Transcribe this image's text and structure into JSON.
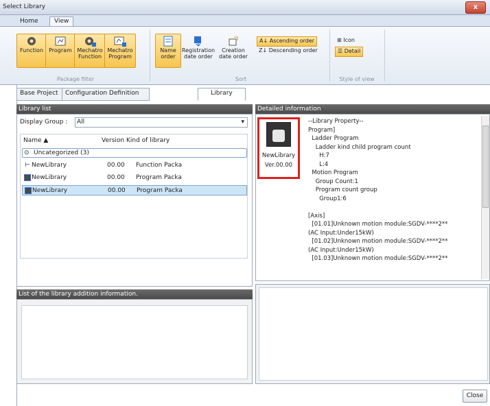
{
  "window": {
    "title": "Select Library",
    "close_symbol": "x"
  },
  "ribbon": {
    "tabs": [
      "Home",
      "View"
    ],
    "package_filter": {
      "label": "Package filter",
      "buttons": [
        "Function",
        "Program",
        "Mechatro\nFunction",
        "Mechatro\nProgram"
      ]
    },
    "sort": {
      "label": "Sort",
      "buttons": [
        "Name\norder",
        "Registration\ndate order",
        "Creation\ndate order"
      ],
      "ascending": "Ascending order",
      "descending": "Descending order"
    },
    "style_of_view": {
      "label": "Style of view",
      "icon": "Icon",
      "detail": "Detail"
    }
  },
  "main_tabs": [
    "Base Project",
    "Configuration Definition",
    "Library"
  ],
  "library_list": {
    "header": "Library list",
    "display_group_label": "Display Group :",
    "display_group_value": "All",
    "columns": [
      "Name ▲",
      "Version",
      "Kind of library"
    ],
    "group_row": "Uncategorized (3)",
    "rows": [
      {
        "name": "NewLibrary",
        "version": "00.00",
        "kind": "Function Packa"
      },
      {
        "name": "NewLibrary",
        "version": "00.00",
        "kind": "Program Packa"
      },
      {
        "name": "NewLibrary",
        "version": "00.00",
        "kind": "Program Packa"
      }
    ]
  },
  "addition_info": {
    "header": "List of the library addition information."
  },
  "detail": {
    "header": "Detailed information",
    "thumb_name": "NewLibrary",
    "thumb_ver": "Ver.00.00",
    "text": "--Library Property--\nProgram]\n  Ladder Program\n    Ladder kind child program count\n      H:7\n      L:4\n  Motion Program\n    Group Count:1\n    Program count group\n      Group1:6\n\n[Axis]\n  [01.01]Unknown motion module:SGDV-****2**\n(AC Input:Under15kW)\n  [01.02]Unknown motion module:SGDV-****2**\n(AC Input:Under15kW)\n  [01.03]Unknown motion module:SGDV-****2**"
  },
  "footer": {
    "close": "Close"
  },
  "colors": {
    "accent": "#f7c54e",
    "highlight_box": "#e0201a",
    "panel_header": "#555555"
  }
}
